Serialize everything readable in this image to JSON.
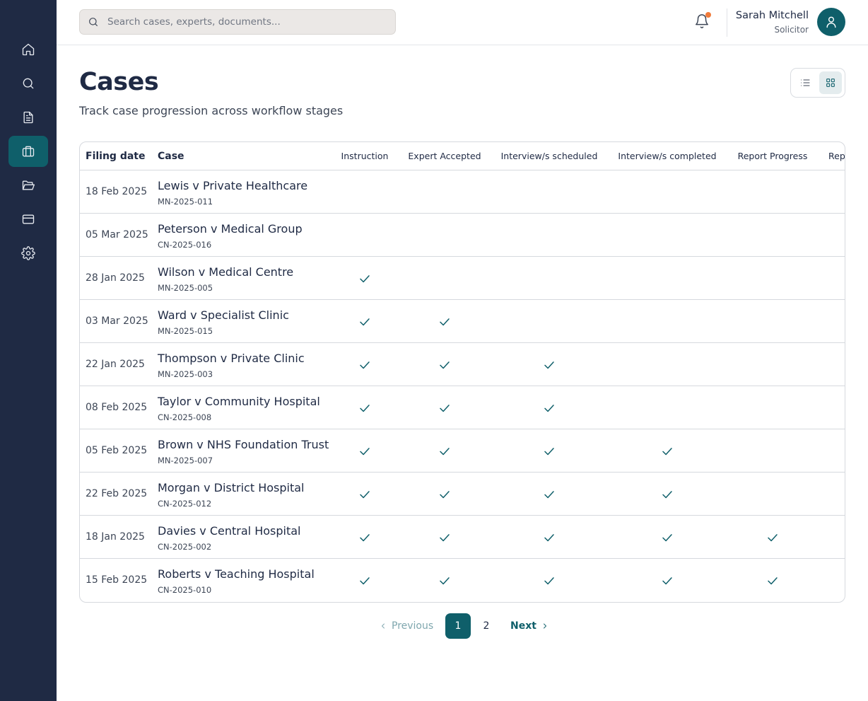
{
  "sidebar": {
    "items": [
      {
        "name": "home",
        "icon": "home-icon",
        "active": false
      },
      {
        "name": "search",
        "icon": "search-icon",
        "active": false
      },
      {
        "name": "documents",
        "icon": "document-icon",
        "active": false
      },
      {
        "name": "cases",
        "icon": "briefcase-icon",
        "active": true
      },
      {
        "name": "folders",
        "icon": "folder-open-icon",
        "active": false
      },
      {
        "name": "billing",
        "icon": "credit-card-icon",
        "active": false
      },
      {
        "name": "settings",
        "icon": "gear-icon",
        "active": false
      }
    ]
  },
  "header": {
    "search_placeholder": "Search cases, experts, documents...",
    "user_name": "Sarah Mitchell",
    "user_role": "Solicitor",
    "notification_indicator": true
  },
  "page": {
    "title": "Cases",
    "subtitle": "Track case progression across workflow stages",
    "view_modes": [
      "list",
      "grid"
    ],
    "active_view": "grid"
  },
  "table": {
    "columns": {
      "filing_date": "Filing date",
      "case": "Case",
      "stages": [
        "Instruction",
        "Expert Accepted",
        "Interview/s scheduled",
        "Interview/s completed",
        "Report Progress",
        "Rep"
      ]
    },
    "rows": [
      {
        "date": "18 Feb 2025",
        "name": "Lewis v Private Healthcare",
        "ref": "MN-2025-011",
        "stages_complete": 0
      },
      {
        "date": "05 Mar 2025",
        "name": "Peterson v Medical Group",
        "ref": "CN-2025-016",
        "stages_complete": 0
      },
      {
        "date": "28 Jan 2025",
        "name": "Wilson v Medical Centre",
        "ref": "MN-2025-005",
        "stages_complete": 1
      },
      {
        "date": "03 Mar 2025",
        "name": "Ward v Specialist Clinic",
        "ref": "MN-2025-015",
        "stages_complete": 2
      },
      {
        "date": "22 Jan 2025",
        "name": "Thompson v Private Clinic",
        "ref": "MN-2025-003",
        "stages_complete": 3
      },
      {
        "date": "08 Feb 2025",
        "name": "Taylor v Community Hospital",
        "ref": "CN-2025-008",
        "stages_complete": 3
      },
      {
        "date": "05 Feb 2025",
        "name": "Brown v NHS Foundation Trust",
        "ref": "MN-2025-007",
        "stages_complete": 4
      },
      {
        "date": "22 Feb 2025",
        "name": "Morgan v District Hospital",
        "ref": "CN-2025-012",
        "stages_complete": 4
      },
      {
        "date": "18 Jan 2025",
        "name": "Davies v Central Hospital",
        "ref": "CN-2025-002",
        "stages_complete": 5
      },
      {
        "date": "15 Feb 2025",
        "name": "Roberts v Teaching Hospital",
        "ref": "CN-2025-010",
        "stages_complete": 5
      }
    ]
  },
  "pagination": {
    "previous_label": "Previous",
    "next_label": "Next",
    "pages": [
      "1",
      "2"
    ],
    "current_page": "1"
  },
  "colors": {
    "sidebar_bg": "#1f2a44",
    "accent": "#0f5f6a",
    "notification_dot": "#f07a3a"
  }
}
